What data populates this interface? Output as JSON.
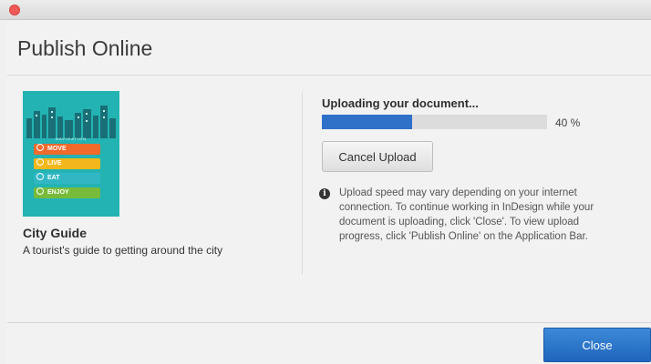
{
  "window": {
    "close_icon": "close-window-icon"
  },
  "dialog": {
    "title": "Publish Online",
    "close_label": "Close"
  },
  "document": {
    "title": "City Guide",
    "description": "A tourist's guide to getting around the city",
    "thumbnail": {
      "subtitle": "NAVIGATION",
      "background_color": "#23b3b3",
      "items": [
        {
          "label": "MOVE",
          "color": "#f06a2c",
          "icon": "compass-icon"
        },
        {
          "label": "LIVE",
          "color": "#f2b81b",
          "icon": "sun-icon"
        },
        {
          "label": "EAT",
          "color": "#31b7c4",
          "icon": "utensils-icon"
        },
        {
          "label": "ENJOY",
          "color": "#78bb3a",
          "icon": "smile-icon"
        }
      ]
    }
  },
  "upload": {
    "status": "Uploading your document...",
    "progress_fraction": 0.4,
    "progress_text": "40 %",
    "cancel_label": "Cancel Upload",
    "info_text": "Upload speed may vary depending on your internet connection. To continue working in InDesign while your document is uploading, click 'Close'. To view upload progress, click 'Publish Online' on the Application Bar.",
    "accent_color": "#2f70c9"
  }
}
